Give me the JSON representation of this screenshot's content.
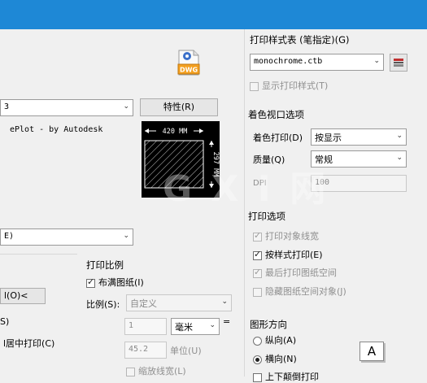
{
  "left": {
    "device_dd_value": "3",
    "properties_button": "特性(R)",
    "plotter_text": "ePlot - by Autodesk",
    "preview": {
      "width_label": "420 MM",
      "height_label": "297 MM"
    },
    "paper_dd_value": "E)",
    "plot_area_button": "l(O)<",
    "plot_offset_fragment": "S)",
    "center_plot_label": "l居中打印(C)"
  },
  "scale": {
    "title": "打印比例",
    "fit_paper_label": "布满图纸(I)",
    "scale_label": "比例(S):",
    "scale_value": "自定义",
    "value1": "1",
    "units": "毫米",
    "equals": "=",
    "value2": "45.2",
    "units_label": "单位(U)",
    "scale_lineweights": "缩放线宽(L)"
  },
  "plot_style": {
    "title": "打印样式表 (笔指定)(G)",
    "table_value": "monochrome.ctb",
    "display_styles_label": "显示打印样式(T)"
  },
  "shaded": {
    "title": "着色视口选项",
    "shade_plot_label": "着色打印(D)",
    "shade_plot_value": "按显示",
    "quality_label": "质量(Q)",
    "quality_value": "常规",
    "dpi_label": "DPI",
    "dpi_value": "100"
  },
  "options": {
    "title": "打印选项",
    "items": [
      {
        "label": "打印对象线宽",
        "checked": true,
        "disabled": true
      },
      {
        "label": "按样式打印(E)",
        "checked": true,
        "disabled": false
      },
      {
        "label": "最后打印图纸空间",
        "checked": true,
        "disabled": true
      },
      {
        "label": "隐藏图纸空间对象(J)",
        "checked": false,
        "disabled": true
      }
    ]
  },
  "orientation": {
    "title": "图形方向",
    "portrait": "纵向(A)",
    "landscape": "横向(N)",
    "upside_down": "上下颠倒打印",
    "icon_letter": "A"
  },
  "dwg_label": "DWG",
  "watermark": "G X I 网"
}
